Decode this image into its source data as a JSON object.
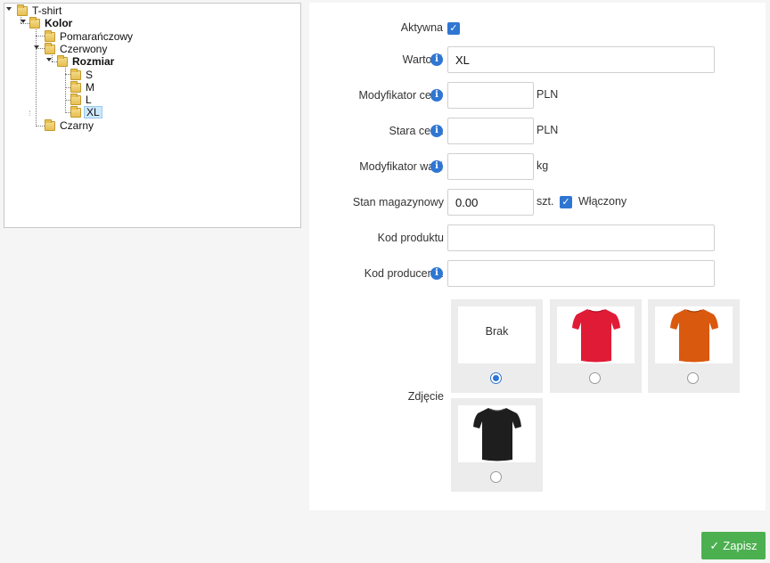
{
  "tree": {
    "nodes": [
      {
        "label": "T-shirt",
        "bold": false
      },
      {
        "label": "Kolor",
        "bold": true
      },
      {
        "label": "Pomarańczowy",
        "bold": false
      },
      {
        "label": "Czerwony",
        "bold": false
      },
      {
        "label": "Rozmiar",
        "bold": true
      },
      {
        "label": "S",
        "bold": false
      },
      {
        "label": "M",
        "bold": false
      },
      {
        "label": "L",
        "bold": false
      },
      {
        "label": "XL",
        "bold": false,
        "selected": true
      },
      {
        "label": "Czarny",
        "bold": false
      }
    ]
  },
  "form": {
    "active": {
      "label": "Aktywna",
      "checked": true
    },
    "value": {
      "label": "Wartość",
      "value": "XL"
    },
    "price_modifier": {
      "label": "Modyfikator ceny",
      "value": "",
      "unit": "PLN"
    },
    "old_price": {
      "label": "Stara cena",
      "value": "",
      "unit": "PLN"
    },
    "weight_modifier": {
      "label": "Modyfikator wagi",
      "value": "",
      "unit": "kg"
    },
    "stock": {
      "label": "Stan magazynowy",
      "value": "0.00",
      "unit": "szt.",
      "enabled_label": "Włączony",
      "enabled": true
    },
    "product_code": {
      "label": "Kod produktu",
      "value": ""
    },
    "producer_code": {
      "label": "Kod producenta",
      "value": ""
    },
    "image": {
      "label": "Zdjęcie",
      "options": [
        {
          "name": "none",
          "label": "Brak",
          "selected": true
        },
        {
          "name": "red-tshirt",
          "color": "#e01b36",
          "selected": false
        },
        {
          "name": "orange-tshirt",
          "color": "#d9590f",
          "selected": false
        },
        {
          "name": "black-tshirt",
          "color": "#1e1e1e",
          "selected": false
        }
      ]
    }
  },
  "save_button": {
    "label": "Zapisz"
  },
  "icons": {
    "info": "info-icon",
    "check": "check-icon",
    "folder": "folder-icon"
  },
  "colors": {
    "accent": "#2f76d2",
    "save": "#4cb050",
    "selection": "#cde8fb"
  }
}
